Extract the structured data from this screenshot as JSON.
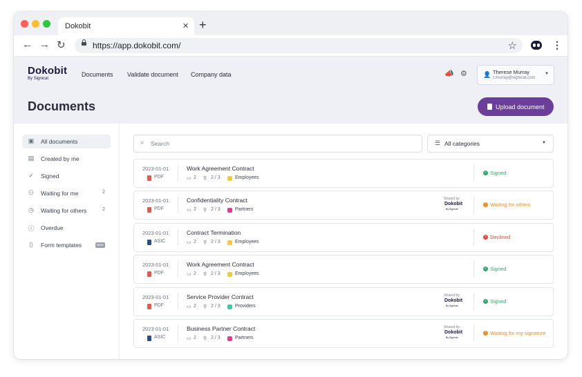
{
  "browser": {
    "tab_title": "Dokobit",
    "tab_close": "×",
    "new_tab": "+",
    "url": "https://app.dokobit.com/"
  },
  "app": {
    "logo": "Dokobit",
    "logo_sub": "By Signicat",
    "nav": [
      "Documents",
      "Validate document",
      "Company data"
    ],
    "user": {
      "name": "Therese Murray",
      "email": "t.murray@signicat.com"
    },
    "page_title": "Documents",
    "upload_label": "Upload document"
  },
  "sidebar": {
    "items": [
      {
        "label": "All documents",
        "count": "",
        "icon": "inbox-icon"
      },
      {
        "label": "Created by me",
        "count": "",
        "icon": "person-card-icon"
      },
      {
        "label": "Signed",
        "count": "",
        "icon": "check-circle-icon"
      },
      {
        "label": "Waiting for me",
        "count": "2",
        "icon": "people-icon"
      },
      {
        "label": "Waiting for others",
        "count": "2",
        "icon": "clock-icon"
      },
      {
        "label": "Overdue",
        "count": "",
        "icon": "alert-circle-icon"
      },
      {
        "label": "Form templates",
        "count": "",
        "icon": "document-icon",
        "badge": "Beta"
      }
    ]
  },
  "filters": {
    "search_placeholder": "Search",
    "category": "All categories"
  },
  "documents": [
    {
      "date": "2023-01-01",
      "type": "PDF",
      "title": "Work Agreement Contract",
      "comments": "2",
      "signers": "2 / 3",
      "category": "Employees",
      "shared": false,
      "status": "Signed"
    },
    {
      "date": "2023-01-01",
      "type": "PDF",
      "title": "Confidentiality Contract",
      "comments": "2",
      "signers": "2 / 3",
      "category": "Partners",
      "shared": true,
      "status": "Waiting for others"
    },
    {
      "date": "2023-01-01",
      "type": "ASIC",
      "title": "Contract Termination",
      "comments": "2",
      "signers": "2 / 3",
      "category": "Employees",
      "shared": false,
      "status": "Declined"
    },
    {
      "date": "2023-01-01",
      "type": "PDF",
      "title": "Work Agreement Contract",
      "comments": "2",
      "signers": "2 / 3",
      "category": "Employees",
      "shared": false,
      "status": "Signed"
    },
    {
      "date": "2023-01-01",
      "type": "PDF",
      "title": "Service Provider Contract",
      "comments": "2",
      "signers": "2 / 3",
      "category": "Providers",
      "shared": true,
      "status": "Signed"
    },
    {
      "date": "2023-01-01",
      "type": "ASIC",
      "title": "Business Partner Contract",
      "comments": "2",
      "signers": "2 / 3",
      "category": "Partners",
      "shared": true,
      "status": "Waiting for my signature"
    }
  ],
  "shared_label": "Shared by",
  "shared_logo": "Dokobit",
  "shared_logo_sub": "By Signicat",
  "colors": {
    "accent": "#6b3f99",
    "brand_dark": "#1c1640",
    "pdf": "#e05a4e",
    "asic": "#2c4a8c",
    "cat_employees": "#f5c842",
    "cat_partners": "#e83a8c",
    "cat_providers": "#3ec9a8",
    "status_signed": "#2fa86b",
    "status_waiting": "#f08a24",
    "status_declined": "#e0443a"
  }
}
